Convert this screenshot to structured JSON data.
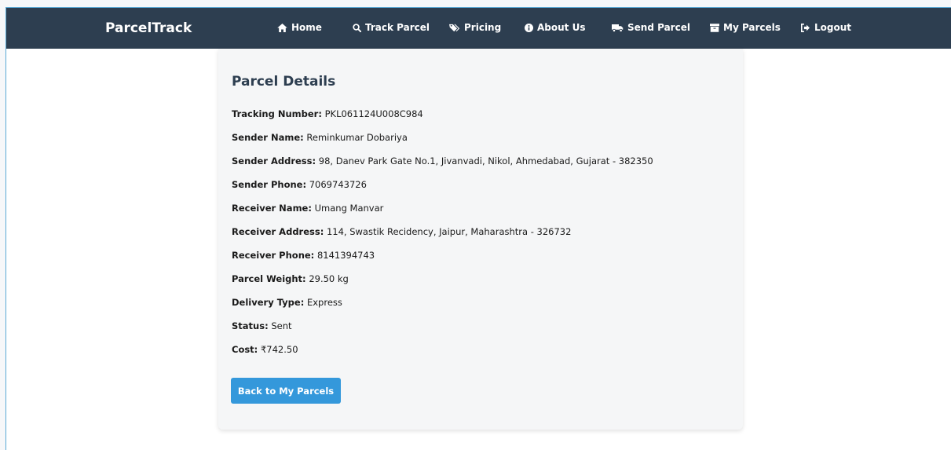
{
  "nav": {
    "brand": "ParcelTrack",
    "items": [
      {
        "label": "Home",
        "icon": "home-icon"
      },
      {
        "label": "Track Parcel",
        "icon": "search-icon"
      },
      {
        "label": "Pricing",
        "icon": "tags-icon"
      },
      {
        "label": "About Us",
        "icon": "info-icon"
      },
      {
        "label": "Send Parcel",
        "icon": "truck-icon"
      },
      {
        "label": "My Parcels",
        "icon": "box-icon"
      },
      {
        "label": "Logout",
        "icon": "logout-icon"
      }
    ]
  },
  "details": {
    "title": "Parcel Details",
    "rows": [
      {
        "label": "Tracking Number:",
        "value": "PKL061124U008C984"
      },
      {
        "label": "Sender Name:",
        "value": "Reminkumar Dobariya"
      },
      {
        "label": "Sender Address:",
        "value": "98, Danev Park Gate No.1, Jivanvadi, Nikol, Ahmedabad, Gujarat - 382350"
      },
      {
        "label": "Sender Phone:",
        "value": "7069743726"
      },
      {
        "label": "Receiver Name:",
        "value": "Umang Manvar"
      },
      {
        "label": "Receiver Address:",
        "value": "114, Swastik Recidency, Jaipur, Maharashtra - 326732"
      },
      {
        "label": "Receiver Phone:",
        "value": "8141394743"
      },
      {
        "label": "Parcel Weight:",
        "value": "29.50 kg"
      },
      {
        "label": "Delivery Type:",
        "value": "Express"
      },
      {
        "label": "Status:",
        "value": "Sent"
      },
      {
        "label": "Cost:",
        "value": "₹742.50"
      }
    ],
    "back_label": "Back to My Parcels"
  },
  "colors": {
    "navbar": "#2d3e50",
    "accent": "#3498db",
    "card": "#f5f6f7"
  }
}
